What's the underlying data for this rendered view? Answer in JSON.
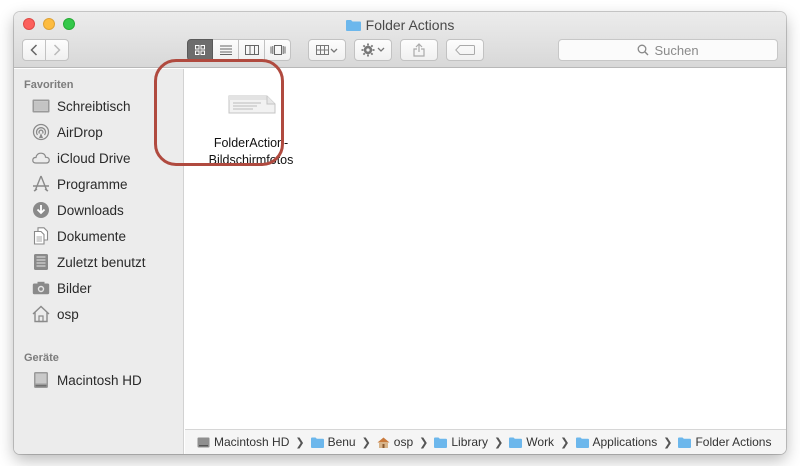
{
  "window": {
    "title": "Folder Actions"
  },
  "toolbar": {
    "search_placeholder": "Suchen"
  },
  "sidebar": {
    "favorites_header": "Favoriten",
    "favorites": [
      {
        "label": "Schreibtisch",
        "icon": "desktop-icon"
      },
      {
        "label": "AirDrop",
        "icon": "airdrop-icon"
      },
      {
        "label": "iCloud Drive",
        "icon": "cloud-icon"
      },
      {
        "label": "Programme",
        "icon": "applications-icon"
      },
      {
        "label": "Downloads",
        "icon": "download-icon"
      },
      {
        "label": "Dokumente",
        "icon": "documents-icon"
      },
      {
        "label": "Zuletzt benutzt",
        "icon": "recents-icon"
      },
      {
        "label": "Bilder",
        "icon": "camera-icon"
      },
      {
        "label": "osp",
        "icon": "home-icon"
      }
    ],
    "devices_header": "Geräte",
    "devices": [
      {
        "label": "Macintosh HD",
        "icon": "hard-drive-icon"
      }
    ]
  },
  "content": {
    "items": [
      {
        "name_line1": "FolderAction-",
        "name_line2": "Bildschirmfotos"
      }
    ]
  },
  "pathbar": {
    "crumbs": [
      "Macintosh HD",
      "Benutz",
      "osp",
      "Library",
      "Workfl",
      "Applications",
      "Folder Actions"
    ]
  },
  "colors": {
    "highlight_ring": "#b04a3f",
    "folder_blue": "#6cb7ec"
  }
}
